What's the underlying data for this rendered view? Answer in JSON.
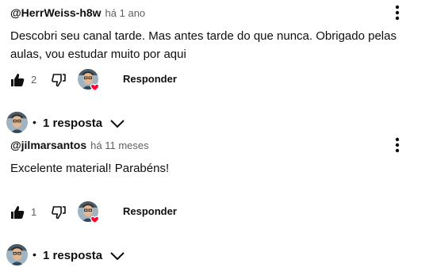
{
  "comments": [
    {
      "author": "@HerrWeiss-h8w",
      "time": "há 1 ano",
      "text": "Descobri seu canal tarde. Mas antes tarde do que nunca. Obrigado pelas aulas, vou estudar muito por aqui",
      "likes": "2",
      "reply_label": "Responder",
      "replies_dot": "•",
      "replies_label": "1 resposta"
    },
    {
      "author": "@jilmarsantos",
      "time": "há 11 meses",
      "text": "Excelente material! Parabéns!",
      "likes": "1",
      "reply_label": "Responder",
      "replies_dot": "•",
      "replies_label": "1 resposta"
    }
  ],
  "icons": {
    "like": "thumbs-up-icon",
    "dislike": "thumbs-down-icon",
    "menu": "more-vert-icon",
    "heart": "creator-heart-icon",
    "expand": "chevron-down-icon"
  },
  "colors": {
    "text": "#0f0f0f",
    "secondary": "#606060",
    "heart": "#ff0033"
  }
}
